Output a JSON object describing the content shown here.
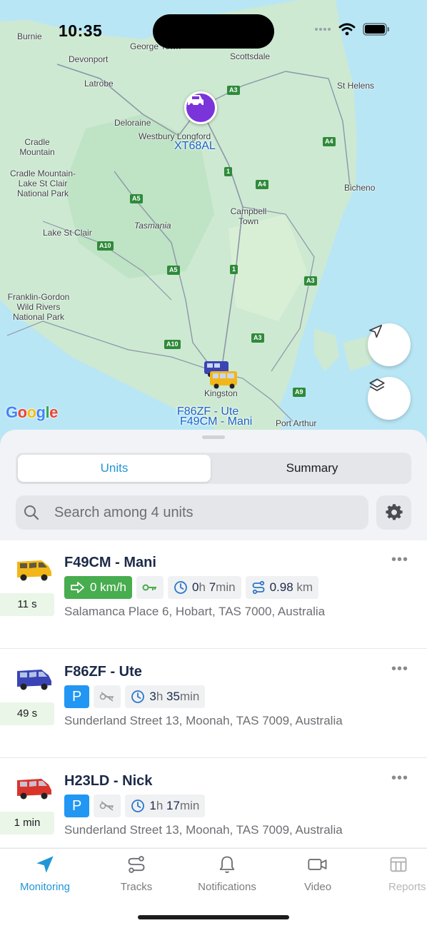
{
  "status_bar": {
    "time": "10:35"
  },
  "map": {
    "place_labels": [
      "Burnie",
      "Devonport",
      "George Town",
      "Scottsdale",
      "St Helens",
      "Latrobe",
      "Deloraine",
      "Westbury Longford",
      "Cradle Mountain",
      "Cradle Mountain-Lake St Clair National Park",
      "Tasmania",
      "Lake St Clair",
      "Campbell Town",
      "Bicheno",
      "Franklin-Gordon Wild Rivers National Park",
      "Kingston",
      "Port Arthur"
    ],
    "road_shields": [
      "A3",
      "A4",
      "A4",
      "1",
      "A5",
      "A10",
      "A5",
      "1",
      "A3",
      "A3",
      "A10",
      "A9"
    ],
    "unit_markers": [
      "XT68AL",
      "F86ZF - Ute",
      "F49CM - Mani"
    ],
    "google_logo": "Google",
    "buttons": {
      "locate_icon": "navigation-arrow-icon",
      "layers_icon": "layers-icon"
    }
  },
  "sheet": {
    "tabs": {
      "units": "Units",
      "summary": "Summary"
    },
    "search": {
      "placeholder": "Search among 4 units",
      "icon": "search-icon"
    },
    "settings_icon": "gear-icon"
  },
  "units": [
    {
      "name": "F49CM - Mani",
      "age": "11 s",
      "vehicle_color": "#f2b619",
      "speed": "0 km/h",
      "ignition_on": true,
      "duration_h": "0",
      "duration_h_unit": "h",
      "duration_m": "7",
      "duration_m_unit": "min",
      "distance": "0.98",
      "distance_unit": "km",
      "address": "Salamanca Place 6, Hobart, TAS 7000, Australia"
    },
    {
      "name": "F86ZF - Ute",
      "age": "49 s",
      "vehicle_color": "#3a44b5",
      "parked_label": "P",
      "duration_h": "3",
      "duration_h_unit": "h",
      "duration_m": "35",
      "duration_m_unit": "min",
      "address": "Sunderland Street 13, Moonah, TAS 7009, Australia"
    },
    {
      "name": "H23LD - Nick",
      "age": "1 min",
      "vehicle_color": "#d9342b",
      "parked_label": "P",
      "duration_h": "1",
      "duration_h_unit": "h",
      "duration_m": "17",
      "duration_m_unit": "min",
      "address": "Sunderland Street 13, Moonah, TAS 7009, Australia"
    }
  ],
  "tab_bar": [
    {
      "label": "Monitoring",
      "icon": "navigation-arrow-icon",
      "active": true
    },
    {
      "label": "Tracks",
      "icon": "route-icon",
      "active": false
    },
    {
      "label": "Notifications",
      "icon": "bell-icon",
      "active": false
    },
    {
      "label": "Video",
      "icon": "video-camera-icon",
      "active": false
    },
    {
      "label": "Reports",
      "icon": "table-icon",
      "active": false
    }
  ],
  "colors": {
    "accent": "#2196d6",
    "moving": "#47ad4e",
    "parked": "#2196f3",
    "sea": "#b9e6f5",
    "land": "#c9e8cf"
  }
}
